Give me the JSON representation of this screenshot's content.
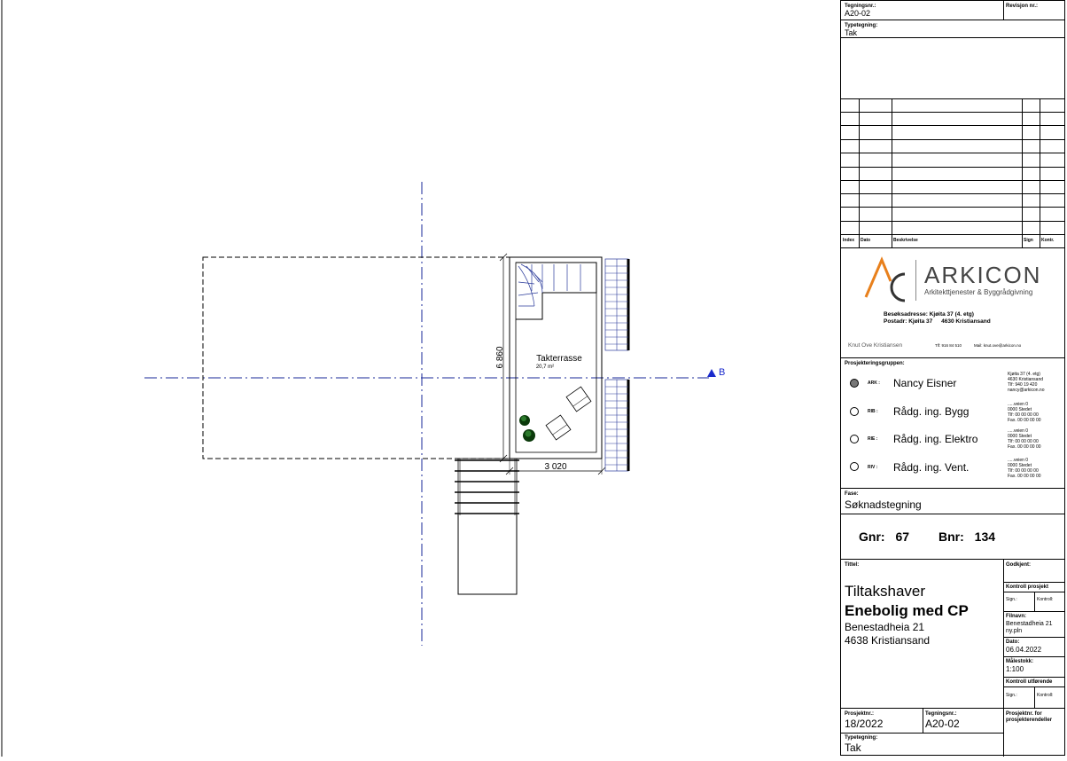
{
  "drawing": {
    "room_name": "Takterrasse",
    "room_area": "20,7 m²",
    "dim_height": "6 860",
    "dim_width": "3 020",
    "section_marker": "B"
  },
  "titleblock": {
    "tegningsnr_label": "Tegningsnr.:",
    "tegningsnr_value": "A20-02",
    "revisjon_label": "Revisjon nr.:",
    "typetegning_label": "Typetegning:",
    "typetegning_value": "Tak",
    "rev_headers": {
      "index": "Index",
      "dato": "Dato",
      "beskrivelse": "Beskrivelse",
      "sign": "Sign",
      "kontr": "Kontr."
    },
    "company": {
      "name": "ARKICON",
      "tagline": "Arkitekttjenester & Byggrådgivning",
      "visit_label": "Besøksadresse:",
      "visit_value": "Kjøita 37 (4. etg)",
      "post_label": "Postadr:",
      "post_value": "Kjøita 37",
      "post_city": "4630 Kristiansand",
      "contact_name": "Knut Ove Kristiansen",
      "contact_phone": "Tlf: 916 84 510",
      "contact_mail": "Mail: knut.ove@arkicon.no"
    },
    "group_label": "Prosjekteringsgruppen:",
    "group": [
      {
        "code": "ARK :",
        "name": "Nancy Eisner",
        "selected": true,
        "info": [
          "Kjøita 37 (4. etg)",
          "4630 Kristiansand",
          "Tlf: 940 19 420",
          "nancy@arkicon.no"
        ]
      },
      {
        "code": "RIB :",
        "name": "Rådg. ing. Bygg",
        "selected": false,
        "info": [
          ".....veien 0",
          "0000 Stedet",
          "Tlf: 00 00 00 00",
          "Fax. 00 00 00 00"
        ]
      },
      {
        "code": "RIE :",
        "name": "Rådg. ing. Elektro",
        "selected": false,
        "info": [
          ".....veien 0",
          "0000 Stedet",
          "Tlf: 00 00 00 00",
          "Fax. 00 00 00 00"
        ]
      },
      {
        "code": "RIV :",
        "name": "Rådg. ing. Vent.",
        "selected": false,
        "info": [
          ".....veien 0",
          "0000 Stedet",
          "Tlf: 00 00 00 00",
          "Fax. 00 00 00 00"
        ]
      }
    ],
    "fase_label": "Fase:",
    "fase_value": "Søknadstegning",
    "gnr_label": "Gnr:",
    "gnr_value": "67",
    "bnr_label": "Bnr:",
    "bnr_value": "134",
    "tittel_label": "Tittel:",
    "tittel_line1": "Tiltakshaver",
    "tittel_line2": "Enebolig med CP",
    "tittel_line3": "Benestadheia 21",
    "tittel_line4": "4638 Kristiansand",
    "godkjent_label": "Godkjent:",
    "kontroll_prosj_label": "Kontroll prosjekt",
    "sign_label": "Sign.:",
    "kontroll_label": "Kontroll:",
    "filnavn_label": "Filnavn:",
    "filnavn_value": "Benestadheia 21 ny.pln",
    "dato_label": "Dato:",
    "dato_value": "06.04.2022",
    "malestokk_label": "Målestokk:",
    "malestokk_value": "1:100",
    "kontroll_utf_label": "Kontroll utførende",
    "prosjektnr_label": "Prosjektnr.:",
    "prosjektnr_value": "18/2022",
    "tegningsnr2_label": "Tegningsnr.:",
    "tegningsnr2_value": "A20-02",
    "prosjektnr_for_label": "Prosjektnr. for prosjekterendeller",
    "typetegning2_label": "Typetegning:",
    "typetegning2_value": "Tak"
  }
}
